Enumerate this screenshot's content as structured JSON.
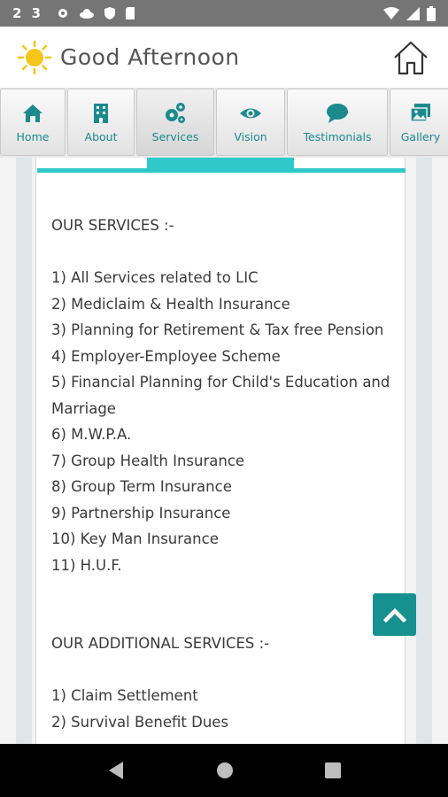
{
  "status": {
    "time": "2 3"
  },
  "header": {
    "greeting": "Good Afternoon"
  },
  "tabs": [
    {
      "label": "Home",
      "icon": "home-icon"
    },
    {
      "label": "About",
      "icon": "building-icon"
    },
    {
      "label": "Services",
      "icon": "gears-icon"
    },
    {
      "label": "Vision",
      "icon": "eye-icon"
    },
    {
      "label": "Testimonials",
      "icon": "chat-bubble-icon"
    },
    {
      "label": "Gallery",
      "icon": "images-icon"
    }
  ],
  "services": {
    "heading": "OUR SERVICES :-",
    "items": [
      "1) All Services related to LIC",
      "2) Mediclaim & Health Insurance",
      "3) Planning for Retirement & Tax free Pension",
      "4) Employer-Employee Scheme",
      "5) Financial Planning for Child's Education and Marriage",
      "6) M.W.P.A.",
      "7) Group Health Insurance",
      "8) Group Term Insurance",
      "9) Partnership Insurance",
      "10) Key Man Insurance",
      "11) H.U.F."
    ],
    "additional_heading": "OUR ADDITIONAL SERVICES :-",
    "additional_items": [
      "1) Claim Settlement",
      "2) Survival Benefit Dues"
    ]
  },
  "colors": {
    "accent": "#17918f",
    "highlight": "#30c9c9",
    "tab_text": "#1a8a8c"
  }
}
